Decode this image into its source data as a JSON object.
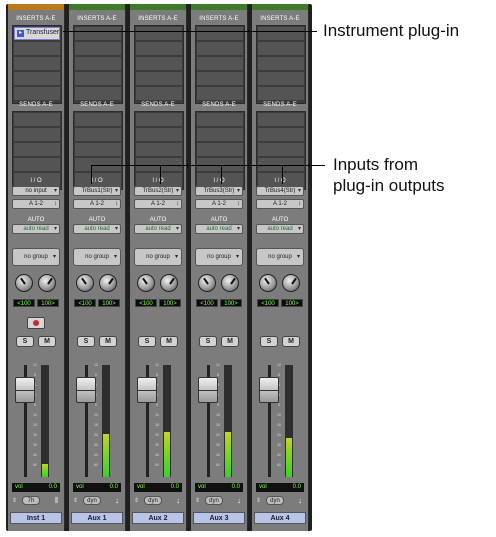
{
  "strips": [
    {
      "name": "Inst 1",
      "inserts_header": "INSERTS A-E",
      "insert": "Transfuser",
      "sends_header": "SENDS A-E",
      "io_header": "I / O",
      "input": "no input",
      "output": "A 1-2",
      "auto_header": "AUTO",
      "auto": "auto read",
      "group": "no group",
      "pan_left": "<100",
      "pan_right": "100>",
      "has_record": true,
      "solo": "S",
      "mute": "M",
      "vol_label": "vol",
      "vol_value": "0.0",
      "bottom": "7h",
      "meter_level": 0.12,
      "top_color": "#b97a1e"
    },
    {
      "name": "Aux 1",
      "inserts_header": "INSERTS A-E",
      "insert": "",
      "sends_header": "SENDS A-E",
      "io_header": "I / O",
      "input": "TrBus1(Str)",
      "output": "A 1-2",
      "auto_header": "AUTO",
      "auto": "auto read",
      "group": "no group",
      "pan_left": "<100",
      "pan_right": "100>",
      "has_record": false,
      "solo": "S",
      "mute": "M",
      "vol_label": "vol",
      "vol_value": "0.0",
      "bottom": "dyn",
      "meter_level": 0.38,
      "top_color": "#3e7a2a"
    },
    {
      "name": "Aux 2",
      "inserts_header": "INSERTS A-E",
      "insert": "",
      "sends_header": "SENDS A-E",
      "io_header": "I / O",
      "input": "TrBus2(Str)",
      "output": "A 1-2",
      "auto_header": "AUTO",
      "auto": "auto read",
      "group": "no group",
      "pan_left": "<100",
      "pan_right": "100>",
      "has_record": false,
      "solo": "S",
      "mute": "M",
      "vol_label": "vol",
      "vol_value": "0.0",
      "bottom": "dyn",
      "meter_level": 0.4,
      "top_color": "#3e7a2a"
    },
    {
      "name": "Aux 3",
      "inserts_header": "INSERTS A-E",
      "insert": "",
      "sends_header": "SENDS A-E",
      "io_header": "I / O",
      "input": "TrBus3(Str)",
      "output": "A 1-2",
      "auto_header": "AUTO",
      "auto": "auto read",
      "group": "no group",
      "pan_left": "<100",
      "pan_right": "100>",
      "has_record": false,
      "solo": "S",
      "mute": "M",
      "vol_label": "vol",
      "vol_value": "0.0",
      "bottom": "dyn",
      "meter_level": 0.4,
      "top_color": "#3e7a2a"
    },
    {
      "name": "Aux 4",
      "inserts_header": "INSERTS A-E",
      "insert": "",
      "sends_header": "SENDS A-E",
      "io_header": "I / O",
      "input": "TrBus4(Str)",
      "output": "A 1-2",
      "auto_header": "AUTO",
      "auto": "auto read",
      "group": "no group",
      "pan_left": "<100",
      "pan_right": "100>",
      "has_record": false,
      "solo": "S",
      "mute": "M",
      "vol_label": "vol",
      "vol_value": "0.0",
      "bottom": "dyn",
      "meter_level": 0.35,
      "top_color": "#3e7a2a"
    }
  ],
  "callouts": {
    "instrument": "Instrument plug-in",
    "inputs_line1": "Inputs from",
    "inputs_line2": "plug-in outputs"
  },
  "colors": {
    "strip_bg": "#7c7c7c",
    "meter_green": "#3ad12a",
    "name_bar": "#b9c5e8"
  }
}
